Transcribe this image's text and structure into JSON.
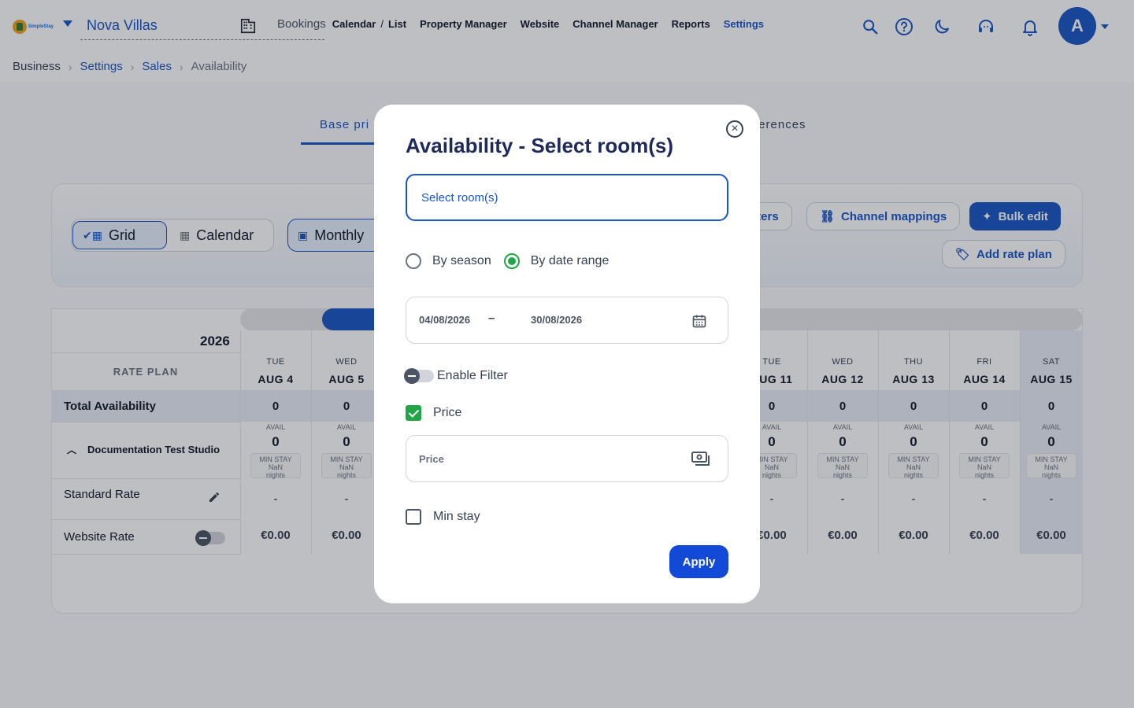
{
  "brand": {
    "logo_text": "SimpleStay"
  },
  "header": {
    "property_name": "Nova Villas",
    "nav": {
      "bookings": "Bookings",
      "calendar": "Calendar",
      "slash": "/",
      "list": "List",
      "property_manager": "Property Manager",
      "website": "Website",
      "channel_manager": "Channel Manager",
      "reports": "Reports",
      "settings": "Settings"
    },
    "avatar_letter": "A"
  },
  "breadcrumb": {
    "items": [
      "Business",
      "Settings",
      "Sales",
      "Availability"
    ],
    "separator": "›"
  },
  "tabs": {
    "base_pricing": "Base pri",
    "preferences": "ferences"
  },
  "toolbar": {
    "grid_label": "Grid",
    "calendar_label": "Calendar",
    "monthly_label": "Monthly",
    "filters_label": "lters",
    "channel_mappings_label": "Channel mappings",
    "bulk_edit_label": "Bulk edit",
    "add_rate_plan_label": "Add rate plan"
  },
  "grid": {
    "year": "2026",
    "rate_plan_header": "RATE PLAN",
    "total_availability_label": "Total Availability",
    "room_name": "Documentation Test Studio",
    "standard_rate_label": "Standard Rate",
    "website_rate_label": "Website Rate",
    "avail_label": "AVAIL",
    "min_stay_line1": "MIN STAY",
    "min_stay_line2": "NaN",
    "min_stay_line3": "nights",
    "days": [
      {
        "dow": "TUE",
        "date": "AUG 4",
        "total": "0",
        "avail": "0",
        "rate": "-",
        "web": "€0.00"
      },
      {
        "dow": "WED",
        "date": "AUG 5",
        "total": "0",
        "avail": "0",
        "rate": "-",
        "web": "€0.00"
      },
      {
        "dow": "TUE",
        "date": "AUG 11",
        "total": "0",
        "avail": "0",
        "rate": "-",
        "web": "€0.00"
      },
      {
        "dow": "WED",
        "date": "AUG 12",
        "total": "0",
        "avail": "0",
        "rate": "-",
        "web": "€0.00"
      },
      {
        "dow": "THU",
        "date": "AUG 13",
        "total": "0",
        "avail": "0",
        "rate": "-",
        "web": "€0.00"
      },
      {
        "dow": "FRI",
        "date": "AUG 14",
        "total": "0",
        "avail": "0",
        "rate": "-",
        "web": "€0.00"
      },
      {
        "dow": "SAT",
        "date": "AUG 15",
        "total": "0",
        "avail": "0",
        "rate": "-",
        "web": "€0.00"
      }
    ]
  },
  "modal": {
    "title": "Availability - Select room(s)",
    "room_placeholder": "Select room(s)",
    "by_season_label": "By season",
    "by_date_range_label": "By date range",
    "selected_mode": "by_date_range",
    "date_from": "04/08/2026",
    "date_separator": "–",
    "date_to": "30/08/2026",
    "enable_filter_label": "Enable Filter",
    "price_label": "Price",
    "price_checked": true,
    "price_placeholder": "Price",
    "min_stay_label": "Min stay",
    "min_stay_checked": false,
    "apply_label": "Apply"
  },
  "colors": {
    "primary": "#1a56c4",
    "success": "#22a447",
    "title": "#1f2a5a"
  }
}
